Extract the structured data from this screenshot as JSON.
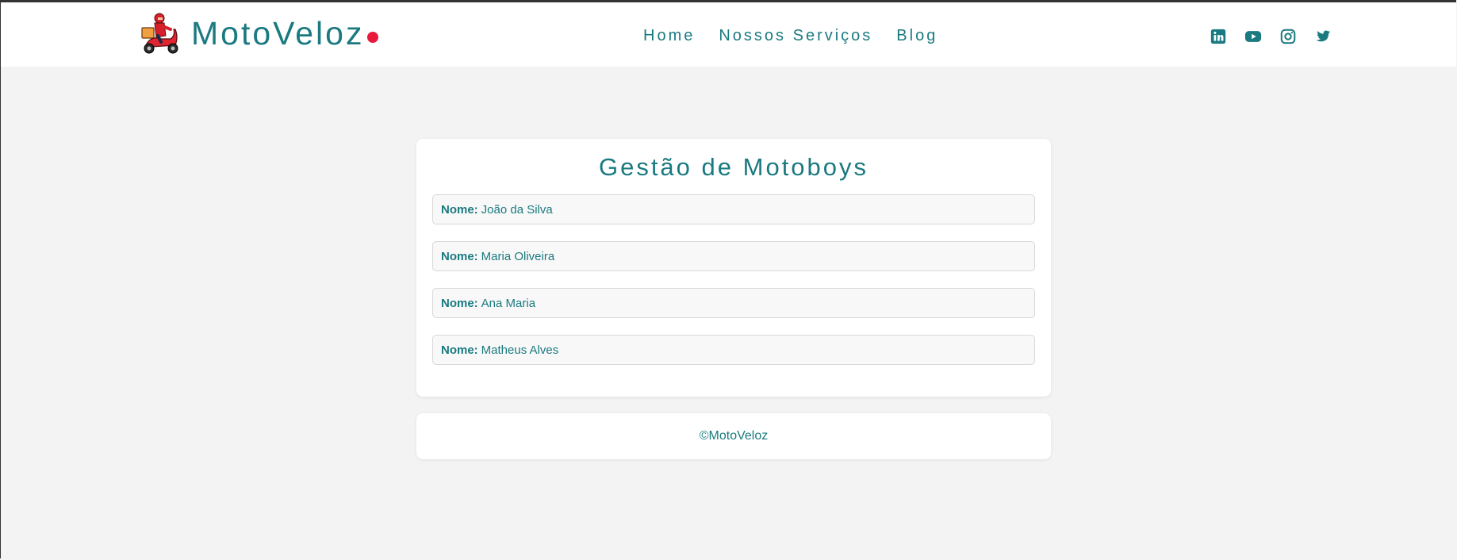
{
  "brand": {
    "name": "MotoVeloz",
    "accent_color": "#1a7a80",
    "dot_color": "#e8193c",
    "logo_icon": "scooter-delivery-icon"
  },
  "nav": {
    "items": [
      {
        "label": "Home"
      },
      {
        "label": "Nossos Serviços"
      },
      {
        "label": "Blog"
      }
    ]
  },
  "social": {
    "icons": [
      "linkedin-icon",
      "youtube-icon",
      "instagram-icon",
      "twitter-icon"
    ]
  },
  "main": {
    "title": "Gestão de Motoboys",
    "field_label": "Nome:",
    "motoboys": [
      {
        "name": "João da Silva"
      },
      {
        "name": "Maria Oliveira"
      },
      {
        "name": "Ana Maria"
      },
      {
        "name": "Matheus Alves"
      }
    ]
  },
  "footer": {
    "text": "©MotoVeloz"
  }
}
